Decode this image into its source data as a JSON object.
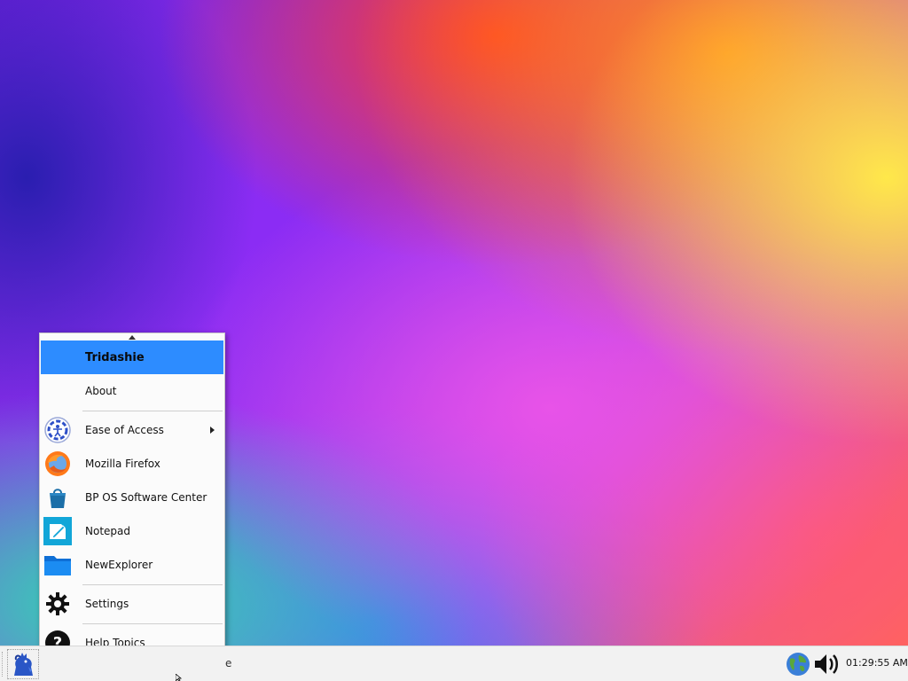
{
  "menu": {
    "header": "Tridashie",
    "items": [
      {
        "label": "About",
        "icon": "none"
      },
      {
        "label": "Ease of Access",
        "icon": "ease-of-access-icon",
        "submenu": true
      },
      {
        "label": "Mozilla Firefox",
        "icon": "firefox-icon"
      },
      {
        "label": "BP OS Software Center",
        "icon": "software-center-icon"
      },
      {
        "label": "Notepad",
        "icon": "notepad-icon"
      },
      {
        "label": "NewExplorer",
        "icon": "folder-icon"
      },
      {
        "label": "Settings",
        "icon": "gear-icon"
      },
      {
        "label": "Help Topics",
        "icon": "help-icon"
      }
    ]
  },
  "taskbar": {
    "task_text": "e",
    "clock": "01:29:55 AM"
  },
  "colors": {
    "header_bg": "#2d8cff",
    "menu_bg": "#fbfbfb",
    "taskbar_bg": "#f2f2f2"
  }
}
